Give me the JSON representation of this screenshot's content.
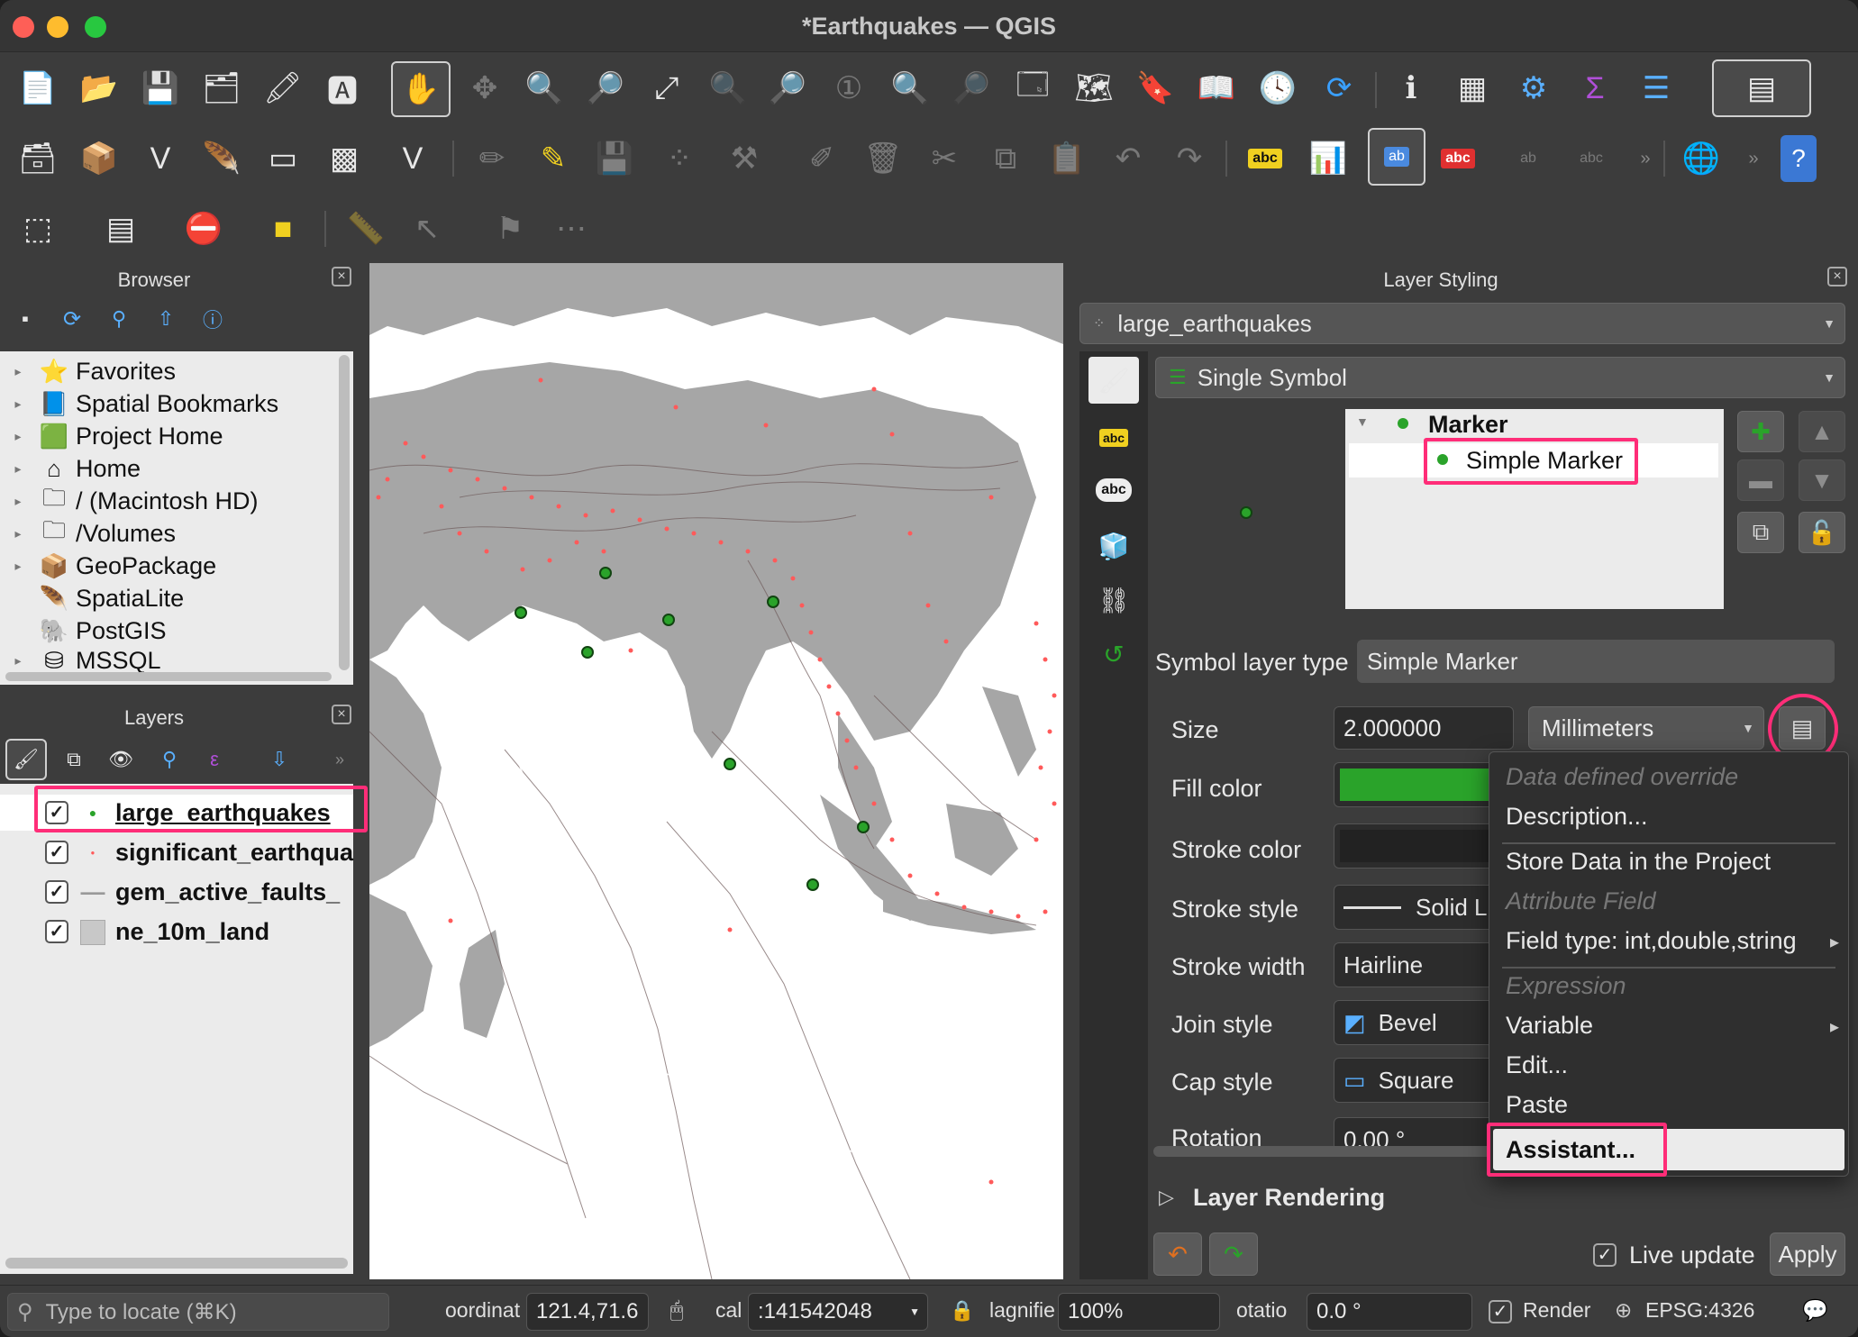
{
  "window": {
    "title": "*Earthquakes — QGIS"
  },
  "browser": {
    "title": "Browser",
    "items": [
      {
        "label": "Favorites",
        "icon": "star-icon"
      },
      {
        "label": "Spatial Bookmarks",
        "icon": "bookmark-icon"
      },
      {
        "label": "Project Home",
        "icon": "project-home-icon"
      },
      {
        "label": "Home",
        "icon": "home-icon"
      },
      {
        "label": "/ (Macintosh HD)",
        "icon": "folder-icon"
      },
      {
        "label": "/Volumes",
        "icon": "folder-icon"
      },
      {
        "label": "GeoPackage",
        "icon": "geopackage-icon"
      },
      {
        "label": "SpatiaLite",
        "icon": "spatialite-icon"
      },
      {
        "label": "PostGIS",
        "icon": "postgis-icon"
      },
      {
        "label": "MSSQL",
        "icon": "mssql-icon"
      }
    ]
  },
  "layers": {
    "title": "Layers",
    "items": [
      {
        "label": "large_earthquakes",
        "checked": true
      },
      {
        "label": "significant_earthqua",
        "checked": true
      },
      {
        "label": "gem_active_faults_",
        "checked": true
      },
      {
        "label": "ne_10m_land",
        "checked": true
      }
    ]
  },
  "styling": {
    "title": "Layer Styling",
    "layer_combo": "large_earthquakes",
    "renderer_combo": "Single Symbol",
    "tree": {
      "root": "Marker",
      "child": "Simple Marker"
    },
    "symbol_layer_type_label": "Symbol layer type",
    "symbol_layer_type_value": "Simple Marker",
    "props": {
      "size_label": "Size",
      "size_value": "2.000000",
      "unit_value": "Millimeters",
      "fill_color_label": "Fill color",
      "fill_color": "#2aa32a",
      "stroke_color_label": "Stroke color",
      "stroke_color": "#222222",
      "stroke_style_label": "Stroke style",
      "stroke_style_value": "Solid Li",
      "stroke_width_label": "Stroke width",
      "stroke_width_value": "Hairline",
      "join_style_label": "Join style",
      "join_style_value": "Bevel",
      "cap_style_label": "Cap style",
      "cap_style_value": "Square",
      "rotation_label": "Rotation",
      "rotation_value": "0.00 °"
    },
    "layer_rendering": "Layer Rendering",
    "live_update": "Live update",
    "apply": "Apply"
  },
  "menu": {
    "header": "Data defined override",
    "description": "Description...",
    "store": "Store Data in the Project",
    "attribute_field": "Attribute Field",
    "field_type": "Field type: int,double,string",
    "expression": "Expression",
    "variable": "Variable",
    "edit": "Edit...",
    "paste": "Paste",
    "assistant": "Assistant..."
  },
  "statusbar": {
    "locate_placeholder": "Type to locate (⌘K)",
    "coord_label": "oordinat",
    "coord_value": "121.4,71.6",
    "scale_label": "cal",
    "scale_value": ":141542048",
    "magnifier_label": "lagnifie",
    "magnifier_value": "100%",
    "rotation_label": "otatio",
    "rotation_value": "0.0 °",
    "render_label": "Render",
    "crs": "EPSG:4326"
  },
  "colors": {
    "highlight": "#ff2d78",
    "map_land": "#a6a6a6",
    "quake_dot": "#ff5a5a",
    "marker_green": "#2aa32a"
  }
}
